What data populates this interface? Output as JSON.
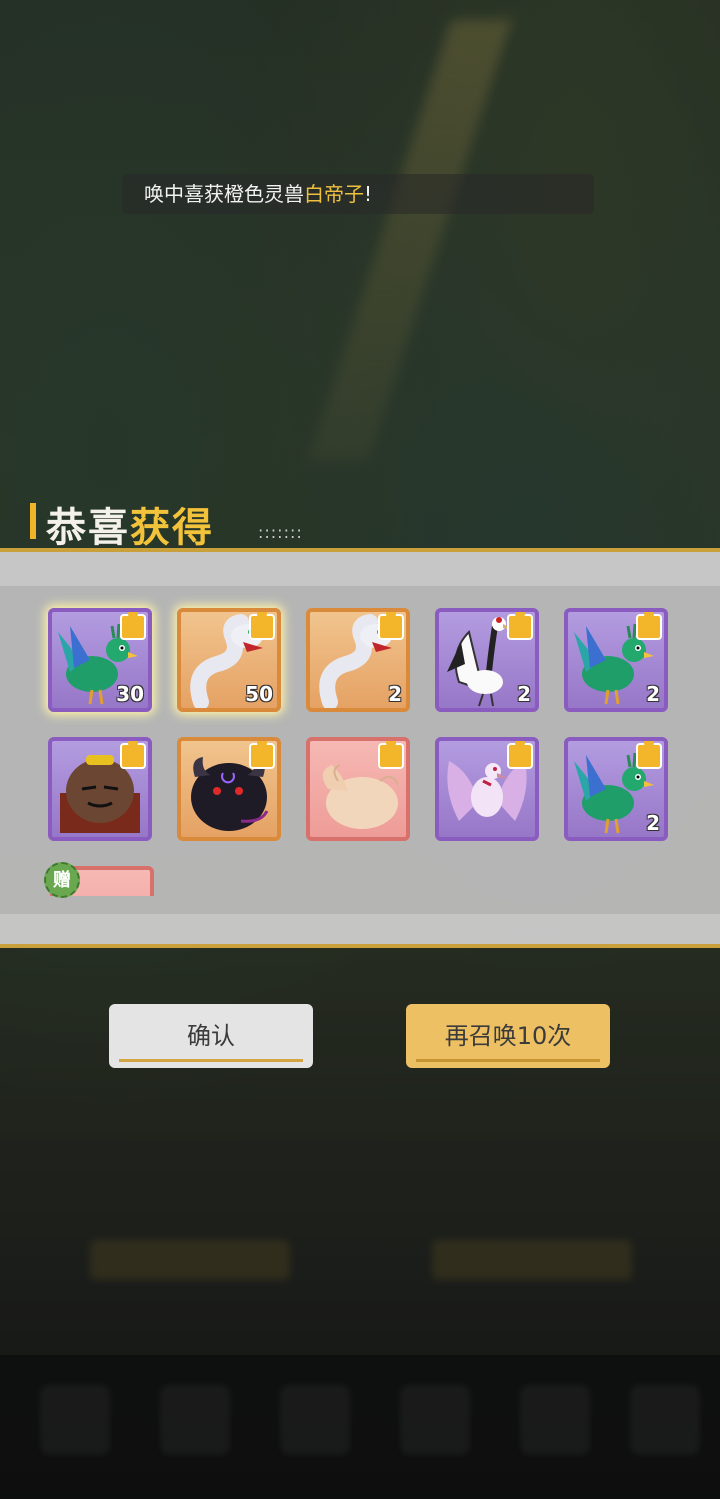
{
  "notice": {
    "prefix": "唤中喜获橙色灵兽",
    "highlight": "白帝子",
    "suffix": "!"
  },
  "title": {
    "part1": "恭喜",
    "part2": "获得",
    "part3": "",
    "dots": ":::::::"
  },
  "rewards": [
    {
      "creature": "green-peacock",
      "rarity": "purple",
      "count": "30",
      "glow": true
    },
    {
      "creature": "white-serpent",
      "rarity": "orange",
      "count": "50",
      "glow": true
    },
    {
      "creature": "white-serpent",
      "rarity": "orange",
      "count": "2",
      "glow": false
    },
    {
      "creature": "red-crowned-crane",
      "rarity": "purple",
      "count": "2",
      "glow": false
    },
    {
      "creature": "green-peacock",
      "rarity": "purple",
      "count": "2",
      "glow": false
    },
    {
      "creature": "furry-brown-beast",
      "rarity": "purple",
      "count": "",
      "glow": false
    },
    {
      "creature": "black-bull",
      "rarity": "orange",
      "count": "",
      "glow": false
    },
    {
      "creature": "winged-bun",
      "rarity": "red",
      "count": "",
      "glow": false
    },
    {
      "creature": "pink-crane",
      "rarity": "purple",
      "count": "",
      "glow": false
    },
    {
      "creature": "green-peacock",
      "rarity": "purple",
      "count": "2",
      "glow": false
    }
  ],
  "gift": {
    "badge": "赠",
    "rarity": "red"
  },
  "buttons": {
    "confirm": "确认",
    "summon_again": "再召唤10次"
  },
  "colors": {
    "gold": "#f2c23a",
    "purple_frame": "#8a5cc0",
    "orange_frame": "#d98a3a",
    "red_frame": "#d8706c"
  }
}
